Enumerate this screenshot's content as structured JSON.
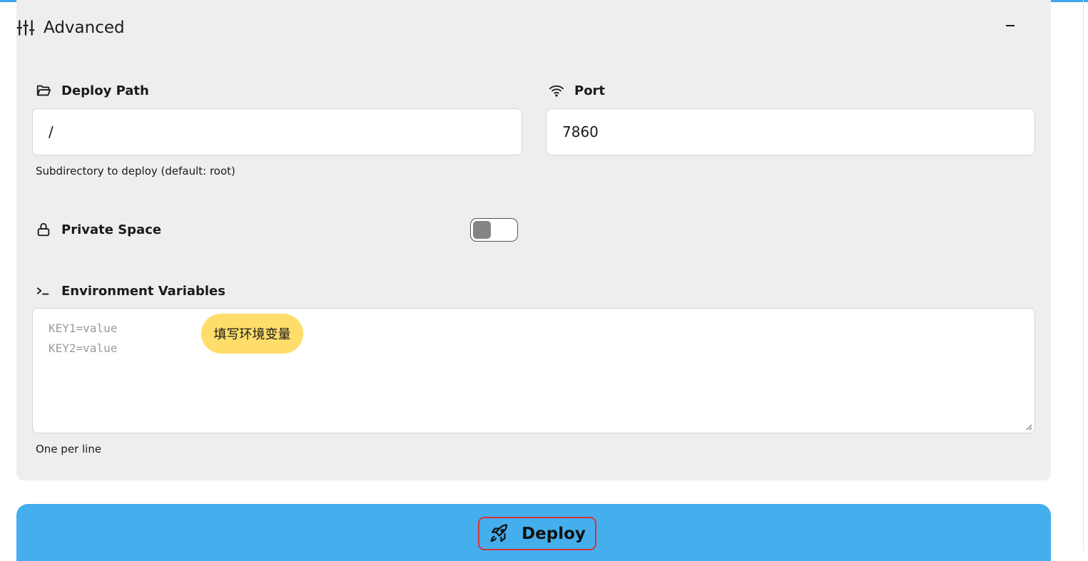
{
  "advanced": {
    "title": "Advanced",
    "collapse_icon": "minus-icon",
    "header_icon": "sliders-icon"
  },
  "deploy_path": {
    "label": "Deploy Path",
    "icon": "folder-open-icon",
    "value": "/",
    "hint": "Subdirectory to deploy (default: root)"
  },
  "port": {
    "label": "Port",
    "icon": "wifi-icon",
    "value": "7860"
  },
  "private_space": {
    "label": "Private Space",
    "icon": "lock-icon",
    "enabled": false
  },
  "env_vars": {
    "label": "Environment Variables",
    "icon": "terminal-icon",
    "placeholder": "KEY1=value\nKEY2=value",
    "hint": "One per line"
  },
  "callout": {
    "text": "填写环境变量"
  },
  "deploy": {
    "label": "Deploy",
    "icon": "rocket-icon"
  },
  "colors": {
    "accent": "#45aeed",
    "callout": "#fedd6a",
    "highlight_border": "#d8323c",
    "panel": "#eeeeee"
  }
}
